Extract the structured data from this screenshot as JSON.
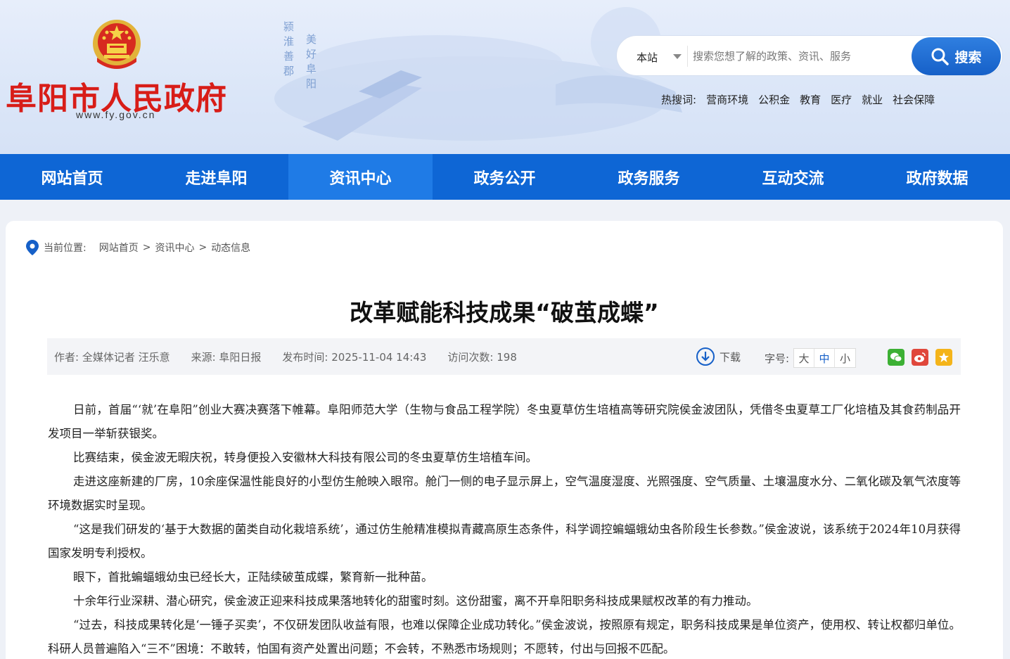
{
  "header": {
    "site_name": "阜阳市人民政府",
    "site_url": "www.fy.gov.cn",
    "slogan_a": "颍淮善郡",
    "slogan_b": "美好阜阳",
    "search": {
      "scope": "本站",
      "placeholder": "搜索您想了解的政策、资讯、服务",
      "button": "搜索"
    },
    "hot": {
      "label": "热搜词:",
      "words": [
        "营商环境",
        "公积金",
        "教育",
        "医疗",
        "就业",
        "社会保障"
      ]
    }
  },
  "nav": {
    "items": [
      "网站首页",
      "走进阜阳",
      "资讯中心",
      "政务公开",
      "政务服务",
      "互动交流",
      "政府数据"
    ],
    "active": "资讯中心"
  },
  "breadcrumb": {
    "label": "当前位置:",
    "items": [
      "网站首页",
      "资讯中心",
      "动态信息"
    ],
    "sep": ">"
  },
  "article": {
    "title": "改革赋能科技成果“破茧成蝶”",
    "meta": {
      "author": "作者: 全媒体记者 汪乐意",
      "source": "来源: 阜阳日报",
      "publish": "发布时间: 2025-11-04 14:43",
      "visits": "访问次数:  198",
      "download": "下载",
      "font_label": "字号:",
      "font_sizes": [
        "大",
        "中",
        "小"
      ]
    },
    "paragraphs": [
      "日前，首届“‘就’在阜阳”创业大赛决赛落下帷幕。阜阳师范大学（生物与食品工程学院）冬虫夏草仿生培植高等研究院侯金波团队，凭借冬虫夏草工厂化培植及其食药制品开发项目一举斩获银奖。",
      "比赛结束，侯金波无暇庆祝，转身便投入安徽林大科技有限公司的冬虫夏草仿生培植车间。",
      "走进这座新建的厂房，10余座保温性能良好的小型仿生舱映入眼帘。舱门一侧的电子显示屏上，空气温度湿度、光照强度、空气质量、土壤温度水分、二氧化碳及氧气浓度等环境数据实时呈现。",
      "“这是我们研发的‘基于大数据的菌类自动化栽培系统’，通过仿生舱精准模拟青藏高原生态条件，科学调控蝙蝠蛾幼虫各阶段生长参数。”侯金波说，该系统于2024年10月获得国家发明专利授权。",
      "眼下，首批蝙蝠蛾幼虫已经长大，正陆续破茧成蝶，繁育新一批种苗。",
      "十余年行业深耕、潜心研究，侯金波正迎来科技成果落地转化的甜蜜时刻。这份甜蜜，离不开阜阳职务科技成果赋权改革的有力推动。",
      "“过去，科技成果转化是‘一锤子买卖’，不仅研发团队收益有限，也难以保障企业成功转化。”侯金波说，按照原有规定，职务科技成果是单位资产，使用权、转让权都归单位。科研人员普遍陷入“三不”困境：不敢转，怕国有资产处置出问题；不会转，不熟悉市场规则；不愿转，付出与回报不匹配。"
    ]
  },
  "colors": {
    "brand_red": "#d81d18",
    "nav_blue": "#0e66d5",
    "nav_active": "#1f7be6",
    "search_blue": "#1660c8"
  }
}
